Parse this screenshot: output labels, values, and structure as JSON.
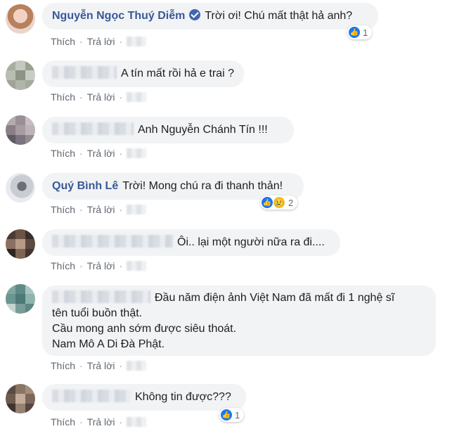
{
  "actions": {
    "like": "Thích",
    "reply": "Trả lời",
    "sep": "·"
  },
  "comments": [
    {
      "name": "Nguyễn Ngọc Thuý Diễm",
      "verified": true,
      "text": "Trời ơi! Chú mất thật hả anh?",
      "reactions": {
        "icons": [
          "like-icon"
        ],
        "count": "1"
      }
    },
    {
      "name": "",
      "text": "A tín mất rồi hả e trai ?"
    },
    {
      "name": "",
      "text": "Anh Nguyễn Chánh Tín !!!"
    },
    {
      "name": "Quý Bình Lê",
      "text": "Trời! Mong chú ra đi thanh thản!",
      "reactions": {
        "icons": [
          "like-icon",
          "sad-icon"
        ],
        "count": "2"
      }
    },
    {
      "name": "",
      "text": "Ôi.. lại một người nữa ra đi...."
    },
    {
      "name": "",
      "text_lines": [
        "Đầu năm điện ảnh Việt Nam đã mất đi 1 nghệ sĩ",
        "tên tuổi buồn thật.",
        "Cầu mong anh sớm được siêu thoát.",
        "Nam Mô A Di Đà Phật."
      ]
    },
    {
      "name": "",
      "text": "Không tin được???",
      "reactions": {
        "icons": [
          "like-icon"
        ],
        "count": "1"
      }
    }
  ],
  "colors": {
    "link": "#385898",
    "bubble": "#f2f3f5",
    "like": "#1877f2",
    "sad": "#f7b928",
    "action": "#616770"
  }
}
